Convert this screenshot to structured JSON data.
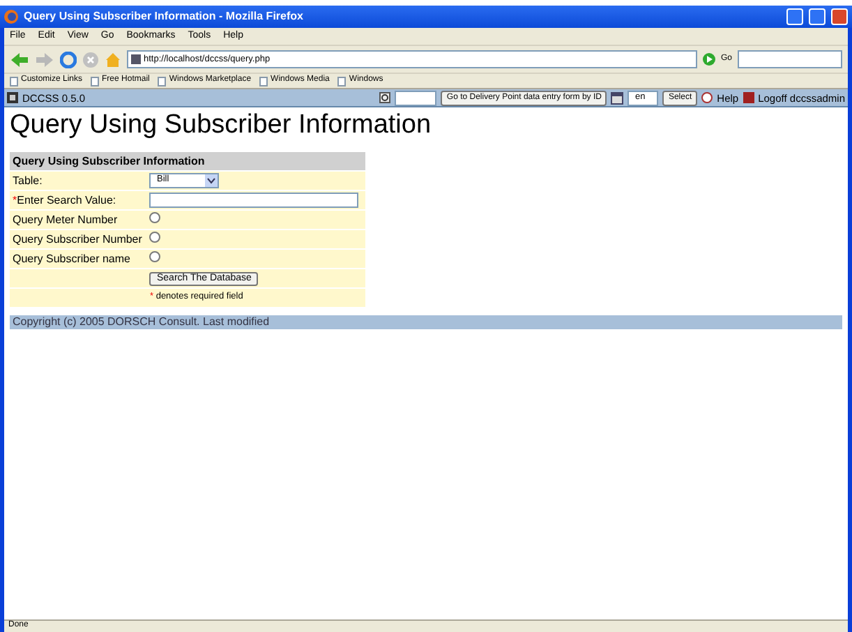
{
  "window": {
    "title": "Query Using Subscriber Information - Mozilla Firefox"
  },
  "menu": [
    "File",
    "Edit",
    "View",
    "Go",
    "Bookmarks",
    "Tools",
    "Help"
  ],
  "address_bar": {
    "value": "http://localhost/dccss/query.php",
    "go": "Go"
  },
  "bookmarks": [
    "Customize Links",
    "Free Hotmail",
    "Windows Marketplace",
    "Windows Media",
    "Windows"
  ],
  "app_bar": {
    "home_link": "DCCSS 0.5.0",
    "goto_button": "Go to Delivery Point data entry form by ID",
    "language": "en",
    "select_button": "Select",
    "help_link": "Help",
    "logoff_link": "Logoff dccssadmin"
  },
  "heading": "Query Using Subscriber Information",
  "form": {
    "caption": "Query Using Subscriber Information",
    "table_label": "Table:",
    "table_value": "Bill",
    "required_mark": "*",
    "search_label": "Enter Search Value:",
    "options": [
      {
        "label": "Query Meter Number",
        "selected": false
      },
      {
        "label": "Query Subscriber Number",
        "selected": false
      },
      {
        "label": "Query Subscriber name",
        "selected": false
      }
    ],
    "submit": "Search The Database",
    "note_mark": "*",
    "note": "denotes required field"
  },
  "footer": "Copyright (c) 2005 DORSCH Consult. Last modified",
  "status_bar": "Done"
}
